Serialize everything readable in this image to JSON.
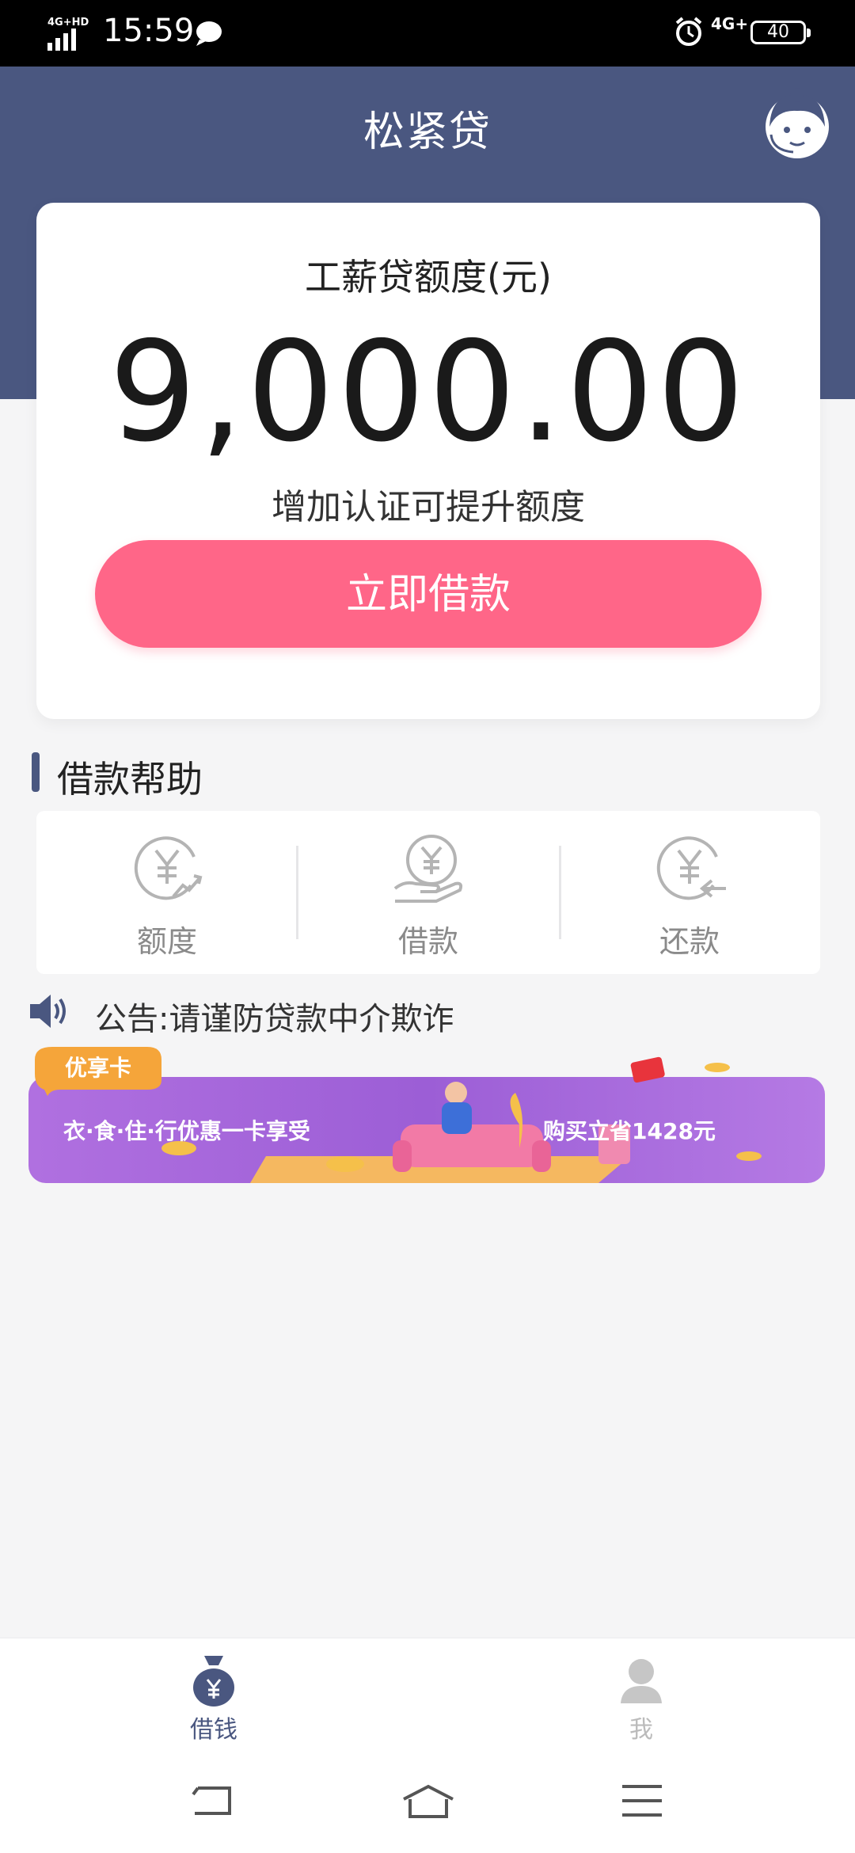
{
  "status_bar": {
    "network": "4G+HD",
    "time": "15:59",
    "network_right": "4G+",
    "battery": "40"
  },
  "header": {
    "title": "松紧贷"
  },
  "card": {
    "label": "工薪贷额度(元)",
    "amount": "9,000.00",
    "hint": "增加认证可提升额度",
    "button_label": "立即借款"
  },
  "help": {
    "title": "借款帮助",
    "items": [
      {
        "label": "额度",
        "icon": "yen-growth-icon"
      },
      {
        "label": "借款",
        "icon": "yen-hand-icon"
      },
      {
        "label": "还款",
        "icon": "yen-return-icon"
      }
    ]
  },
  "notice": {
    "text": "公告:请谨防贷款中介欺诈"
  },
  "banner": {
    "badge": "优享卡",
    "left_text": "衣·食·住·行优惠一卡享受",
    "right_text": "购买立省1428元"
  },
  "bottom_nav": {
    "items": [
      {
        "label": "借钱",
        "active": true
      },
      {
        "label": "我",
        "active": false
      }
    ]
  },
  "colors": {
    "header": "#4a5780",
    "button": "#ff6688",
    "banner": "#a064d8",
    "active_nav": "#4a5780",
    "inactive_nav": "#bbbbbb"
  }
}
